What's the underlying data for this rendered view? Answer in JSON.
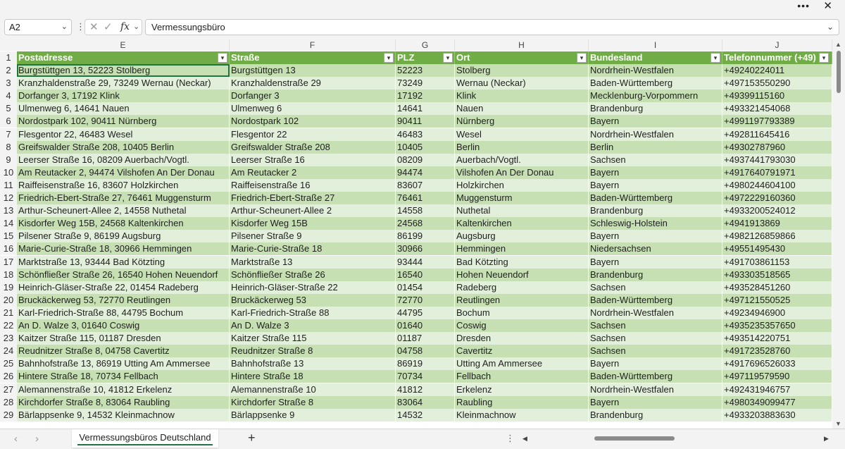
{
  "window": {
    "more_icon": "more-horizontal-icon",
    "close_icon": "close-icon"
  },
  "formula_bar": {
    "name_box": "A2",
    "formula": "Vermessungsbüro"
  },
  "columns": [
    "E",
    "F",
    "G",
    "H",
    "I",
    "J"
  ],
  "header_row_number": "1",
  "headers": [
    "Postadresse",
    "Straße",
    "PLZ",
    "Ort",
    "Bundesland",
    "Telefonnummer (+49)"
  ],
  "rows": [
    {
      "n": "2",
      "cells": [
        "Burgstüttgen 13, 52223 Stolberg",
        "Burgstüttgen 13",
        "52223",
        "Stolberg",
        "Nordrhein-Westfalen",
        "+49240224011"
      ]
    },
    {
      "n": "3",
      "cells": [
        "Kranzhaldenstraße 29, 73249 Wernau (Neckar)",
        "Kranzhaldenstraße 29",
        "73249",
        "Wernau (Neckar)",
        "Baden-Württemberg",
        "+497153550290"
      ]
    },
    {
      "n": "4",
      "cells": [
        "Dorfanger 3, 17192 Klink",
        "Dorfanger 3",
        "17192",
        "Klink",
        "Mecklenburg-Vorpommern",
        "+49399115160"
      ]
    },
    {
      "n": "5",
      "cells": [
        "Ulmenweg 6, 14641 Nauen",
        "Ulmenweg 6",
        "14641",
        "Nauen",
        "Brandenburg",
        "+493321454068"
      ]
    },
    {
      "n": "6",
      "cells": [
        "Nordostpark 102, 90411 Nürnberg",
        "Nordostpark 102",
        "90411",
        "Nürnberg",
        "Bayern",
        "+4991197793389"
      ]
    },
    {
      "n": "7",
      "cells": [
        "Flesgentor 22, 46483 Wesel",
        "Flesgentor 22",
        "46483",
        "Wesel",
        "Nordrhein-Westfalen",
        "+492811645416"
      ]
    },
    {
      "n": "8",
      "cells": [
        "Greifswalder Straße 208, 10405 Berlin",
        "Greifswalder Straße 208",
        "10405",
        "Berlin",
        "Berlin",
        "+49302787960"
      ]
    },
    {
      "n": "9",
      "cells": [
        "Leerser Straße 16, 08209 Auerbach/Vogtl.",
        "Leerser Straße 16",
        "08209",
        "Auerbach/Vogtl.",
        "Sachsen",
        "+4937441793030"
      ]
    },
    {
      "n": "10",
      "cells": [
        "Am Reutacker 2, 94474 Vilshofen An Der Donau",
        "Am Reutacker 2",
        "94474",
        "Vilshofen An Der Donau",
        "Bayern",
        "+4917640791971"
      ]
    },
    {
      "n": "11",
      "cells": [
        "Raiffeisenstraße 16, 83607 Holzkirchen",
        "Raiffeisenstraße 16",
        "83607",
        "Holzkirchen",
        "Bayern",
        "+4980244604100"
      ]
    },
    {
      "n": "12",
      "cells": [
        "Friedrich-Ebert-Straße 27, 76461 Muggensturm",
        "Friedrich-Ebert-Straße 27",
        "76461",
        "Muggensturm",
        "Baden-Württemberg",
        "+4972229160360"
      ]
    },
    {
      "n": "13",
      "cells": [
        "Arthur-Scheunert-Allee 2, 14558 Nuthetal",
        "Arthur-Scheunert-Allee 2",
        "14558",
        "Nuthetal",
        "Brandenburg",
        "+4933200524012"
      ]
    },
    {
      "n": "14",
      "cells": [
        "Kisdorfer Weg 15B, 24568 Kaltenkirchen",
        "Kisdorfer Weg 15B",
        "24568",
        "Kaltenkirchen",
        "Schleswig-Holstein",
        "+4941913869"
      ]
    },
    {
      "n": "15",
      "cells": [
        "Pilsener Straße 9, 86199 Augsburg",
        "Pilsener Straße 9",
        "86199",
        "Augsburg",
        "Bayern",
        "+4982126859866"
      ]
    },
    {
      "n": "16",
      "cells": [
        "Marie-Curie-Straße 18, 30966 Hemmingen",
        "Marie-Curie-Straße 18",
        "30966",
        "Hemmingen",
        "Niedersachsen",
        "+49551495430"
      ]
    },
    {
      "n": "17",
      "cells": [
        "Marktstraße 13, 93444 Bad Kötzting",
        "Marktstraße 13",
        "93444",
        "Bad Kötzting",
        "Bayern",
        "+491703861153"
      ]
    },
    {
      "n": "18",
      "cells": [
        "Schönfließer Straße 26, 16540 Hohen Neuendorf",
        "Schönfließer Straße 26",
        "16540",
        "Hohen Neuendorf",
        "Brandenburg",
        "+493303518565"
      ]
    },
    {
      "n": "19",
      "cells": [
        "Heinrich-Gläser-Straße 22, 01454 Radeberg",
        "Heinrich-Gläser-Straße 22",
        "01454",
        "Radeberg",
        "Sachsen",
        "+493528451260"
      ]
    },
    {
      "n": "20",
      "cells": [
        "Bruckäckerweg 53, 72770 Reutlingen",
        "Bruckäckerweg 53",
        "72770",
        "Reutlingen",
        "Baden-Württemberg",
        "+497121550525"
      ]
    },
    {
      "n": "21",
      "cells": [
        "Karl-Friedrich-Straße 88, 44795 Bochum",
        "Karl-Friedrich-Straße 88",
        "44795",
        "Bochum",
        "Nordrhein-Westfalen",
        "+49234946900"
      ]
    },
    {
      "n": "22",
      "cells": [
        "An D. Walze 3, 01640 Coswig",
        "An D. Walze 3",
        "01640",
        "Coswig",
        "Sachsen",
        "+4935235357650"
      ]
    },
    {
      "n": "23",
      "cells": [
        "Kaitzer Straße 115, 01187 Dresden",
        "Kaitzer Straße 115",
        "01187",
        "Dresden",
        "Sachsen",
        "+493514220751"
      ]
    },
    {
      "n": "24",
      "cells": [
        "Reudnitzer Straße 8, 04758 Cavertitz",
        "Reudnitzer Straße 8",
        "04758",
        "Cavertitz",
        "Sachsen",
        "+491723528760"
      ]
    },
    {
      "n": "25",
      "cells": [
        "Bahnhofstraße 13, 86919 Utting Am Ammersee",
        "Bahnhofstraße 13",
        "86919",
        "Utting Am Ammersee",
        "Bayern",
        "+4917696526033"
      ]
    },
    {
      "n": "26",
      "cells": [
        "Hintere Straße 18, 70734 Fellbach",
        "Hintere Straße 18",
        "70734",
        "Fellbach",
        "Baden-Württemberg",
        "+497119579590"
      ]
    },
    {
      "n": "27",
      "cells": [
        "Alemannenstraße 10, 41812 Erkelenz",
        "Alemannenstraße 10",
        "41812",
        "Erkelenz",
        "Nordrhein-Westfalen",
        "+492431946757"
      ]
    },
    {
      "n": "28",
      "cells": [
        "Kirchdorfer Straße 8, 83064 Raubling",
        "Kirchdorfer Straße 8",
        "83064",
        "Raubling",
        "Bayern",
        "+4980349099477"
      ]
    },
    {
      "n": "29",
      "cells": [
        "Bärlappsenke 9, 14532 Kleinmachnow",
        "Bärlappsenke 9",
        "14532",
        "Kleinmachnow",
        "Brandenburg",
        "+4933203883630"
      ]
    }
  ],
  "sheet_tab": "Vermessungsbüros Deutschland",
  "add_sheet": "+",
  "colors": {
    "header_green": "#70ad47",
    "band_dark": "#c6e0b4",
    "band_light": "#e2efda",
    "accent": "#217346"
  }
}
